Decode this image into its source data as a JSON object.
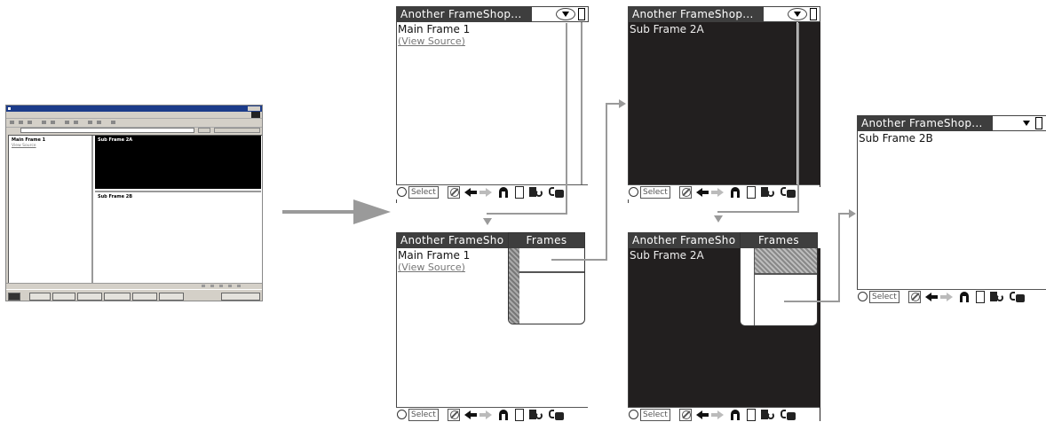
{
  "app_title": "Another FrameShop...",
  "app_title_truncated": "Another FrameSho",
  "frames_popup_title": "Frames",
  "desktop_browser": {
    "left_frame_title": "Main Frame 1",
    "left_frame_link": "View Source",
    "top_right_frame_title": "Sub Frame 2A",
    "bottom_right_frame_title": "Sub Frame 2B"
  },
  "screens": {
    "main_frame": {
      "heading": "Main Frame 1",
      "link": "(View Source)"
    },
    "sub_frame_2a": {
      "heading": "Sub Frame 2A"
    },
    "sub_frame_2b": {
      "heading": "Sub Frame 2B"
    }
  },
  "toolbar": {
    "select_label": "Select"
  },
  "icons": [
    "dropdown-triangle-icon",
    "menu-oval-icon",
    "scroll-indicator-icon",
    "circle-icon",
    "prohibit-icon",
    "back-arrow-icon",
    "forward-arrow-icon",
    "home-icon",
    "page-icon",
    "rotate-icon",
    "lock-icon"
  ],
  "colors": {
    "title_bar": "#3e3e3e",
    "black_frame": "#221f1f",
    "connector": "#9a9a9a"
  }
}
